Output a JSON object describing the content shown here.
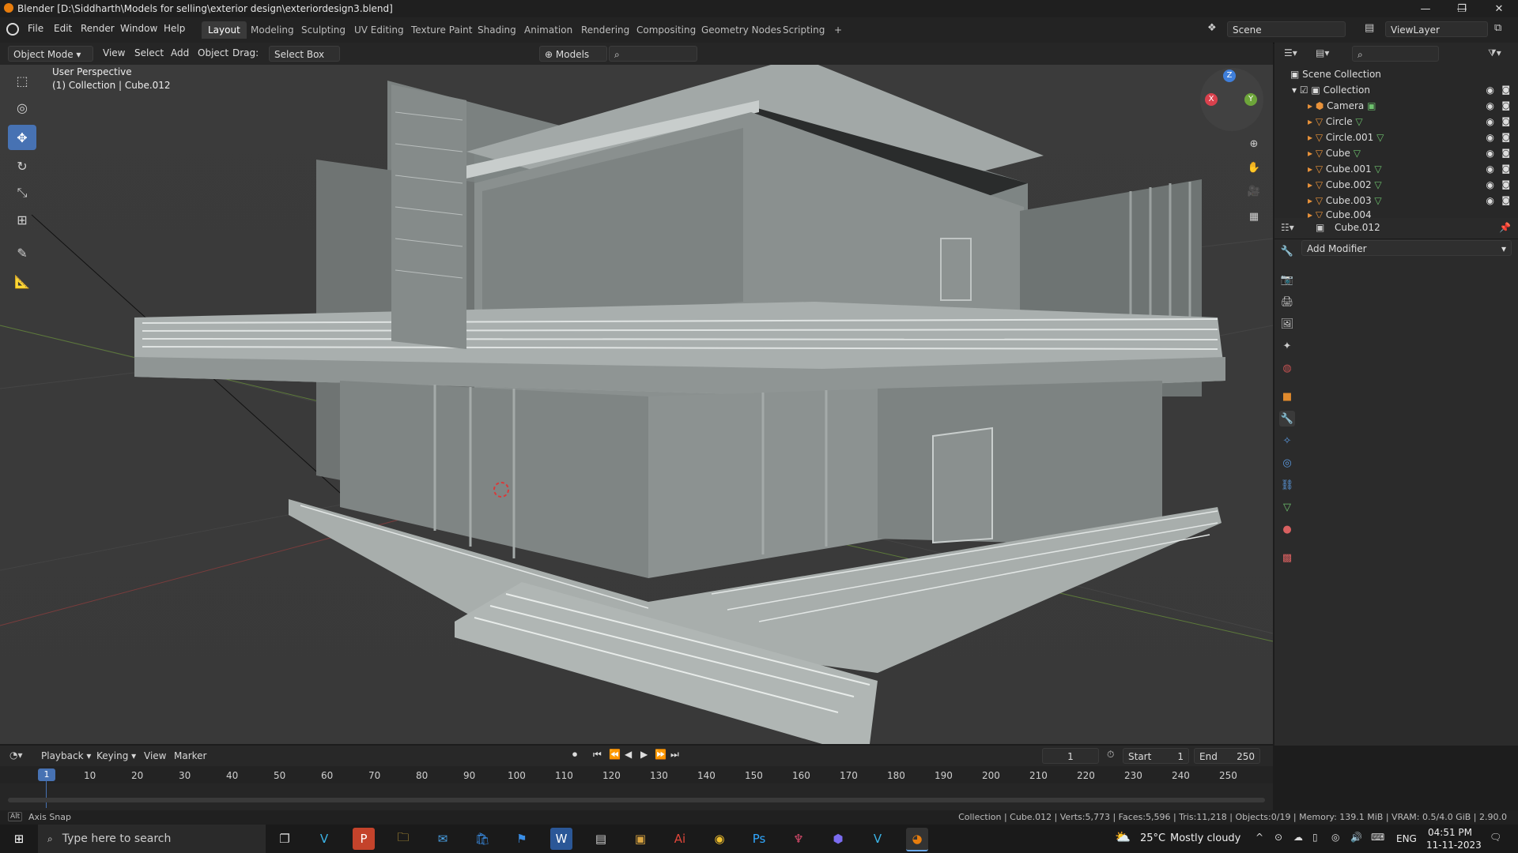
{
  "window": {
    "title": "Blender [D:\\Siddharth\\Models for selling\\exterior design\\exteriordesign3.blend]",
    "min": "—",
    "restore": "❐",
    "close": "✕"
  },
  "menu": {
    "items": [
      "File",
      "Edit",
      "Render",
      "Window",
      "Help"
    ]
  },
  "workspaces": [
    "Layout",
    "Modeling",
    "Sculpting",
    "UV Editing",
    "Texture Paint",
    "Shading",
    "Animation",
    "Rendering",
    "Compositing",
    "Geometry Nodes",
    "Scripting",
    "+"
  ],
  "scene": {
    "label": "Scene",
    "viewlayer": "ViewLayer"
  },
  "viewport_header": {
    "mode": "Object Mode",
    "view": "View",
    "select": "Select",
    "add": "Add",
    "object": "Object",
    "drag_label": "Drag:",
    "drag_value": "Select Box",
    "models": "Models"
  },
  "viewport": {
    "perspective": "User Perspective",
    "collection": "(1) Collection | Cube.012",
    "gizmo": {
      "x": "X",
      "y": "Y",
      "z": "Z"
    }
  },
  "outliner": {
    "root": "Scene Collection",
    "collection": "Collection",
    "items": [
      "Camera",
      "Circle",
      "Circle.001",
      "Cube",
      "Cube.001",
      "Cube.002",
      "Cube.003",
      "Cube.004"
    ]
  },
  "properties": {
    "object_name": "Cube.012",
    "add_modifier": "Add Modifier"
  },
  "timeline": {
    "playback": "Playback",
    "keying": "Keying",
    "view": "View",
    "marker": "Marker",
    "current_frame": "1",
    "start_label": "Start",
    "start": "1",
    "end_label": "End",
    "end": "250",
    "ticks": [
      "1",
      "10",
      "20",
      "30",
      "40",
      "50",
      "60",
      "70",
      "80",
      "90",
      "100",
      "110",
      "120",
      "130",
      "140",
      "150",
      "160",
      "170",
      "180",
      "190",
      "200",
      "210",
      "220",
      "230",
      "240",
      "250"
    ]
  },
  "status": {
    "left": "Axis Snap",
    "right": "Collection | Cube.012 | Verts:5,773 | Faces:5,596 | Tris:11,218 | Objects:0/19 | Memory: 139.1 MiB | VRAM: 0.5/4.0 GiB | 2.90.0"
  },
  "taskbar": {
    "search": "Type here to search",
    "weather_temp": "25°C",
    "weather_desc": "Mostly cloudy",
    "lang": "ENG",
    "time": "04:51 PM",
    "date": "11-11-2023"
  }
}
